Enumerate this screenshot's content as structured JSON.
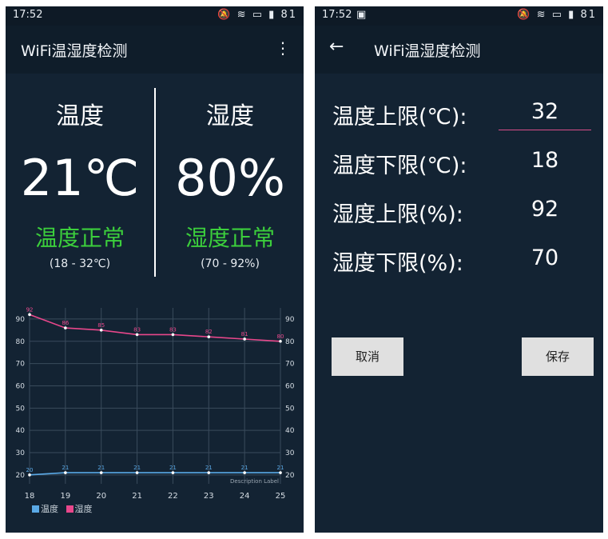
{
  "status": {
    "time": "17:52",
    "battery": "81"
  },
  "left": {
    "app_title": "WiFi温湿度检测",
    "temperature": {
      "label": "温度",
      "value": "21℃",
      "status": "温度正常",
      "range": "(18 - 32℃)"
    },
    "humidity": {
      "label": "湿度",
      "value": "80%",
      "status": "湿度正常",
      "range": "(70 - 92%)"
    },
    "legend": {
      "temp": "温度",
      "humidity": "湿度"
    },
    "description": "Description Label"
  },
  "chart_data": {
    "type": "line",
    "x": [
      18,
      19,
      20,
      21,
      22,
      23,
      24,
      25
    ],
    "ylim": [
      16,
      95
    ],
    "y_ticks": [
      20,
      30,
      40,
      50,
      60,
      70,
      80,
      90
    ],
    "series": [
      {
        "name": "温度",
        "values": [
          20,
          21,
          21,
          21,
          21,
          21,
          21,
          21
        ],
        "color": "#5aa9e6"
      },
      {
        "name": "湿度",
        "values": [
          92,
          86,
          85,
          83,
          83,
          82,
          81,
          80
        ],
        "color": "#e8478b"
      }
    ],
    "grid": true,
    "legend_position": "bottom-left"
  },
  "right": {
    "app_title": "WiFi温湿度检测",
    "fields": [
      {
        "label": "温度上限(℃):",
        "value": "32"
      },
      {
        "label": "温度下限(℃):",
        "value": "18"
      },
      {
        "label": "湿度上限(%):",
        "value": "92"
      },
      {
        "label": "湿度下限(%):",
        "value": "70"
      }
    ],
    "cancel_label": "取消",
    "save_label": "保存"
  },
  "colors": {
    "background": "#132333",
    "status_ok": "#3ccf3c",
    "temp_line": "#5aa9e6",
    "humidity_line": "#e8478b",
    "accent_underline": "#d84e8a"
  }
}
